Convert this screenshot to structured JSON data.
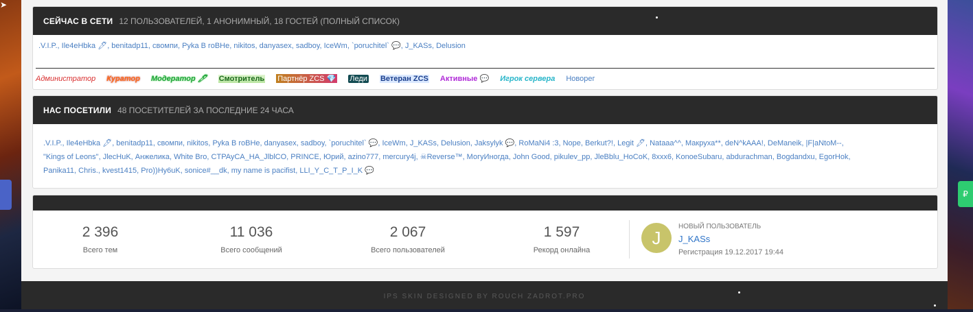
{
  "online": {
    "title": "СЕЙЧАС В СЕТИ",
    "subtitle": "12 ПОЛЬЗОВАТЕЛЕЙ, 1 АНОНИМНЫЙ, 18 ГОСТЕЙ (ПОЛНЫЙ СПИСОК)",
    "users": ".V.I.P., Ile4eHbka 🖊, benitadp11, свомпи, Pyka B roBHe, nikitos, danyasex, sadboy, IceWm, `poruchitel` 💬, J_KASs, Delusion",
    "legend": [
      "Администратор",
      "Куратор",
      "Модератор 🖊",
      "Смотритель",
      "Партнёр ZCS 💎",
      "Леди",
      "Ветеран ZCS",
      "Активные 💬",
      "Игрок сервера",
      "Новорег"
    ]
  },
  "visited": {
    "title": "НАС ПОСЕТИЛИ",
    "subtitle": "48 ПОСЕТИТЕЛЕЙ ЗА ПОСЛЕДНИЕ 24 ЧАСА",
    "line1": ".V.I.P., Ile4eHbka 🖊, benitadp11, свомпи, nikitos, Pyka B roBHe, danyasex, sadboy, `poruchitel` 💬, IceWm, J_KASs, Delusion, Jaksylyk 💬, RoMaNi4 :3, Nope, Berkut?!, Legit 🖊, Nataaa^^, Макруха**, deN^kAAA!, DeManeik, |F|aNtoM--,",
    "line2": "\"Kings of Leons\", JlecHuK, Анжелика, White Bro, CTPAyCA_HA_JlblCO, PRINCE, Юрий, azino777, mercury4j, ☠Reverse™, МогуИногда, John Good, pikulev_pp, JleBblu_HoCoK, 8xxx6, KonoeSubaru, abdurachman, Bogdandxu, EgorHok,",
    "line3": "Panika11, Chris., kvest1415, Pro))Ну6uK, sonice#__dk, my name is pacifist, LLI_Y_C_T_P_I_K 💬"
  },
  "stats": {
    "topics_value": "2 396",
    "topics_label": "Всего тем",
    "posts_value": "11 036",
    "posts_label": "Всего сообщений",
    "users_value": "2 067",
    "users_label": "Всего пользователей",
    "record_value": "1 597",
    "record_label": "Рекорд онлайна"
  },
  "newest": {
    "heading": "НОВЫЙ ПОЛЬЗОВАТЕЛЬ",
    "avatar_letter": "J",
    "username": "J_KASs",
    "registered": "Регистрация 19.12.2017 19:44"
  },
  "footer": {
    "text": "IPS SKIN DESIGNED BY ROUCH ZADROT.PRO"
  },
  "colors": {
    "header_bg": "#2a2a2a",
    "link": "#4a7fc2",
    "avatar": "#c8c46a"
  }
}
